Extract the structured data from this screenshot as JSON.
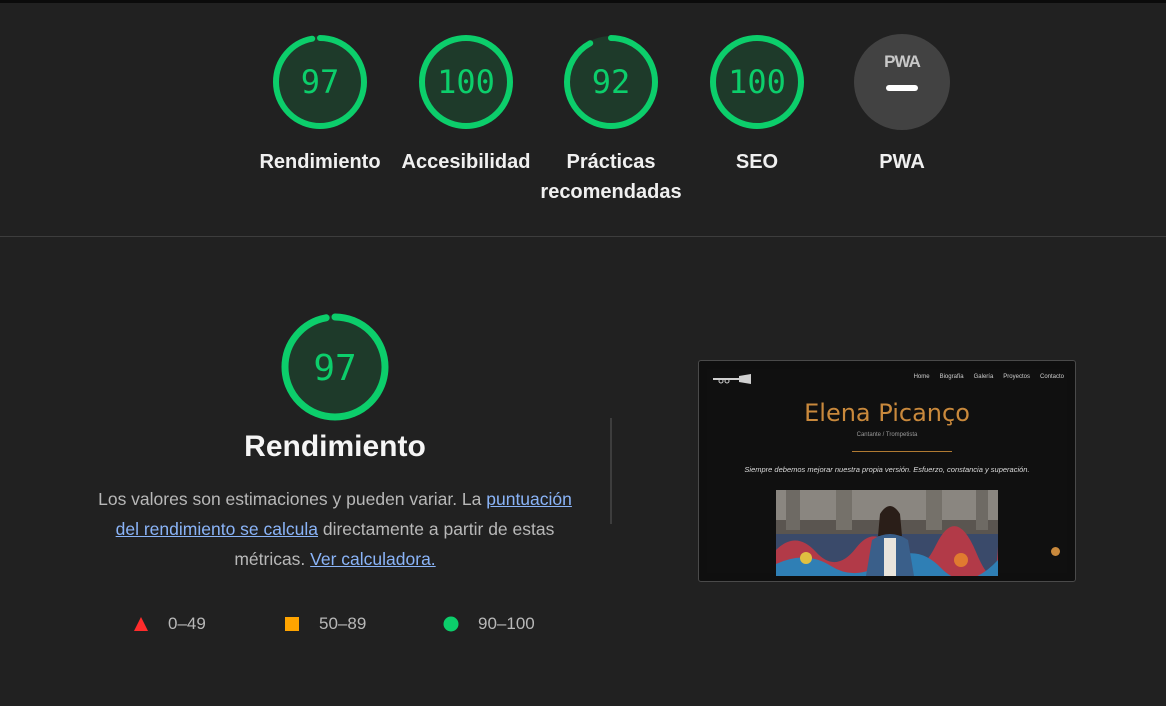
{
  "colors": {
    "background": "#212121",
    "pass": "#0cce6b",
    "average": "#ffa400",
    "fail": "#ff4e42",
    "link": "#8ab4f8"
  },
  "categories": [
    {
      "label": "Rendimiento",
      "score": 97
    },
    {
      "label": "Accesibilidad",
      "score": 100
    },
    {
      "label": "Prácticas recomendadas",
      "score": 92
    },
    {
      "label": "SEO",
      "score": 100
    },
    {
      "label": "PWA",
      "badge": "PWA",
      "icon": "pwa-icon"
    }
  ],
  "performance": {
    "score": 97,
    "title": "Rendimiento",
    "desc_1": "Los valores son estimaciones y pueden variar. La ",
    "link_1": "puntuación del rendimiento se calcula",
    "desc_2": " directamente a partir de estas métricas. ",
    "link_2": "Ver calculadora."
  },
  "legend": [
    {
      "range": "0–49",
      "icon": "triangle-icon"
    },
    {
      "range": "50–89",
      "icon": "square-icon"
    },
    {
      "range": "90–100",
      "icon": "circle-icon"
    }
  ],
  "screenshot": {
    "nav": [
      "Home",
      "Biografía",
      "Galería",
      "Proyectos",
      "Contacto"
    ],
    "name": "Elena Picanço",
    "subtitle": "Cantante / Trompetista",
    "quote": "Siempre debemos mejorar nuestra propia versión. Esfuerzo, constancia y superación."
  }
}
